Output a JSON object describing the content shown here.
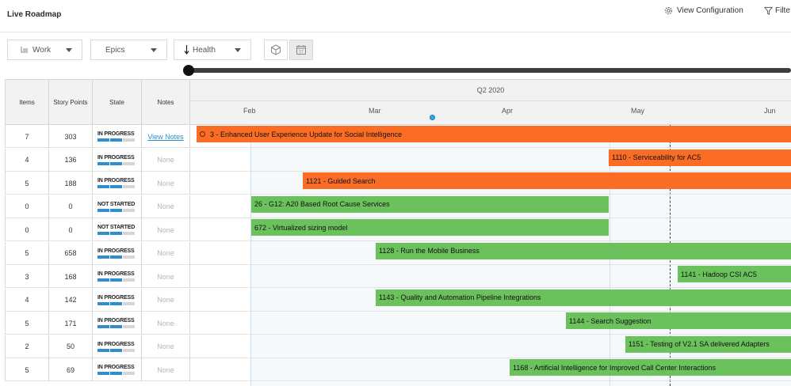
{
  "header": {
    "title": "Live Roadmap",
    "view_configuration": "View Configuration",
    "filter": "Filte"
  },
  "toolbar": {
    "work": "Work",
    "epics": "Epics",
    "health": "Health",
    "icons": [
      "cube-icon",
      "calendar-icon"
    ],
    "calendar_day": "17"
  },
  "grid": {
    "columns": {
      "items": "Items",
      "story_points": "Story Points",
      "state": "State",
      "notes": "Notes"
    },
    "quarter": "Q2 2020",
    "months": [
      "Feb",
      "Mar",
      "Apr",
      "May",
      "Jun"
    ]
  },
  "rows": [
    {
      "items": "7",
      "points": "303",
      "state": "IN PROGRESS",
      "progress": 0.6,
      "notes": "View Notes",
      "notes_link": true,
      "bar": "3 - Enhanced User Experience Update for Social Intelligence",
      "color": "#fb6d24",
      "icon": true
    },
    {
      "items": "4",
      "points": "136",
      "state": "IN PROGRESS",
      "progress": 0.6,
      "notes": "None",
      "notes_link": false,
      "bar": "1110 - Serviceability for AC5",
      "color": "#fb6d24"
    },
    {
      "items": "5",
      "points": "188",
      "state": "IN PROGRESS",
      "progress": 0.6,
      "notes": "None",
      "notes_link": false,
      "bar": "1121 - Guided Search",
      "color": "#fb6d24"
    },
    {
      "items": "0",
      "points": "0",
      "state": "NOT STARTED",
      "progress": 0.6,
      "notes": "None",
      "notes_link": false,
      "bar": "26 - G12: A20 Based Root Cause Services",
      "color": "#6bc25d"
    },
    {
      "items": "0",
      "points": "0",
      "state": "NOT STARTED",
      "progress": 0.6,
      "notes": "None",
      "notes_link": false,
      "bar": "672 - Virtualized sizing model",
      "color": "#6bc25d"
    },
    {
      "items": "5",
      "points": "658",
      "state": "IN PROGRESS",
      "progress": 0.6,
      "notes": "None",
      "notes_link": false,
      "bar": "1128 - Run the Mobile Business",
      "color": "#6bc25d"
    },
    {
      "items": "3",
      "points": "168",
      "state": "IN PROGRESS",
      "progress": 0.6,
      "notes": "None",
      "notes_link": false,
      "bar": "1141 - Hadoop CSI AC5",
      "color": "#6bc25d"
    },
    {
      "items": "4",
      "points": "142",
      "state": "IN PROGRESS",
      "progress": 0.6,
      "notes": "None",
      "notes_link": false,
      "bar": "1143 - Quality and Automation Pipeline Integrations",
      "color": "#6bc25d"
    },
    {
      "items": "5",
      "points": "171",
      "state": "IN PROGRESS",
      "progress": 0.6,
      "notes": "None",
      "notes_link": false,
      "bar": "1144 - Search Suggestion",
      "color": "#6bc25d"
    },
    {
      "items": "2",
      "points": "50",
      "state": "IN PROGRESS",
      "progress": 0.6,
      "notes": "None",
      "notes_link": false,
      "bar": "1151 - Testing of V2.1 SA delivered Adapters",
      "color": "#6bc25d"
    },
    {
      "items": "5",
      "points": "69",
      "state": "IN PROGRESS",
      "progress": 0.6,
      "notes": "None",
      "notes_link": false,
      "bar": "1168 - Artificial Intelligence for Improved Call Center Interactions",
      "color": "#6bc25d"
    }
  ]
}
